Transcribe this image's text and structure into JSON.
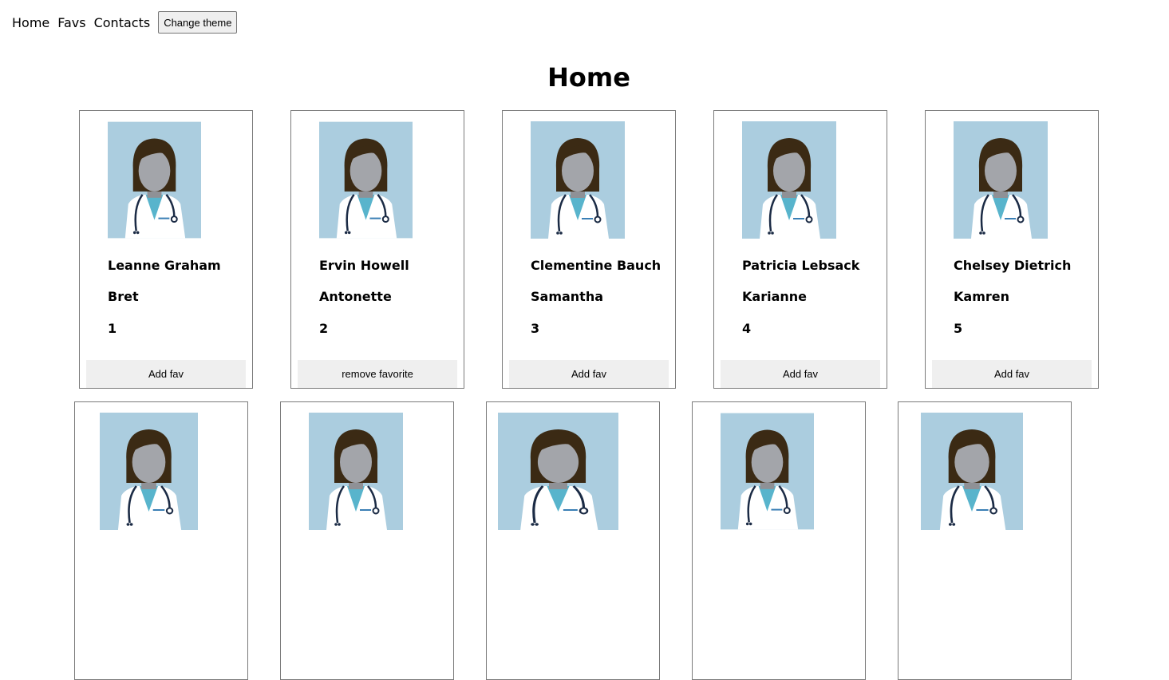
{
  "nav": {
    "links": [
      "Home",
      "Favs",
      "Contacts"
    ],
    "theme_button": "Change theme"
  },
  "page_title": "Home",
  "users": [
    {
      "name": "Leanne Graham",
      "username": "Bret",
      "id": "1",
      "fav_label": "Add fav"
    },
    {
      "name": "Ervin Howell",
      "username": "Antonette",
      "id": "2",
      "fav_label": "remove favorite"
    },
    {
      "name": "Clementine Bauch",
      "username": "Samantha",
      "id": "3",
      "fav_label": "Add fav"
    },
    {
      "name": "Patricia Lebsack",
      "username": "Karianne",
      "id": "4",
      "fav_label": "Add fav"
    },
    {
      "name": "Chelsey Dietrich",
      "username": "Kamren",
      "id": "5",
      "fav_label": "Add fav"
    }
  ],
  "colors": {
    "photo_bg": "#abcddf",
    "hair": "#3b2a14",
    "face": "#a3a5aa",
    "scrubs": "#58b4cc",
    "coat": "#ffffff",
    "stethoscope": "#1b2b45"
  },
  "avatar_icon": "doctor-avatar-icon"
}
